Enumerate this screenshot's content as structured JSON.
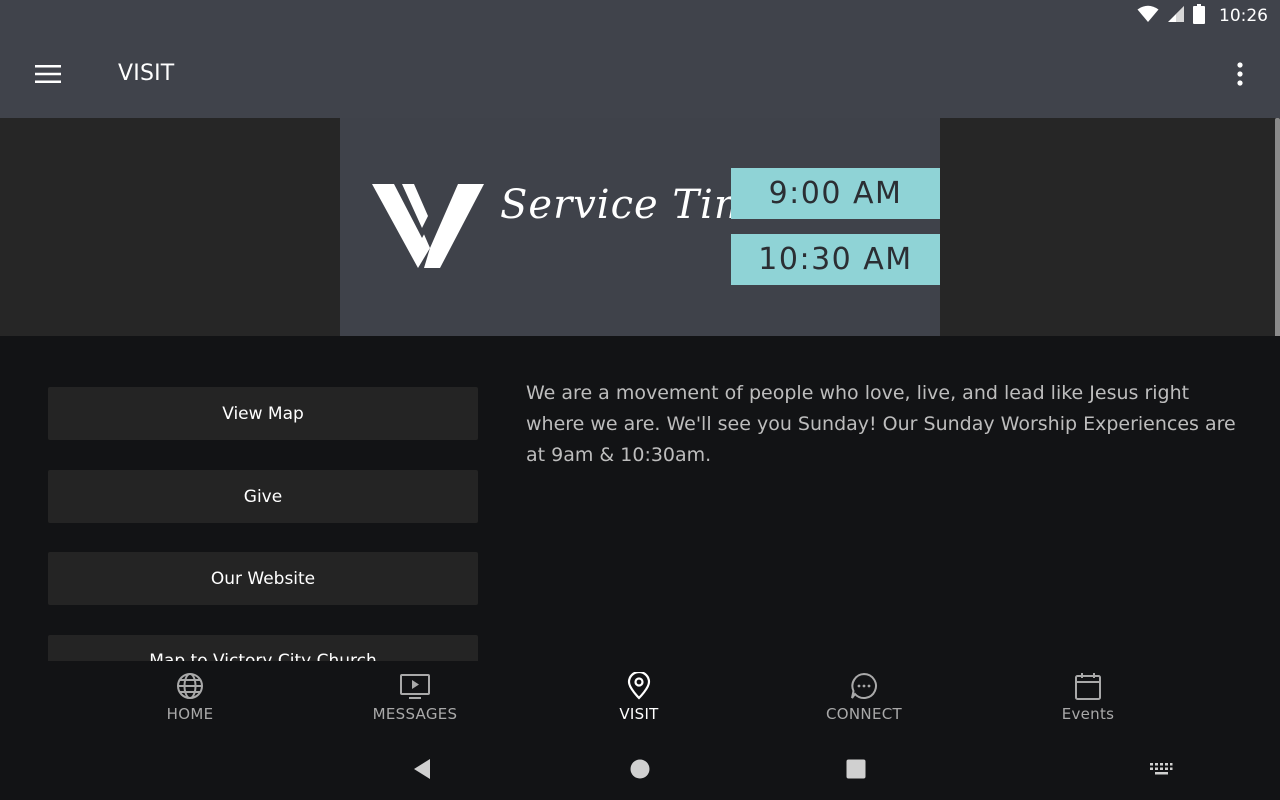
{
  "status": {
    "time": "10:26"
  },
  "appbar": {
    "title": "VISIT"
  },
  "hero": {
    "script_text": "Service Times",
    "times": [
      "9:00 AM",
      "10:30 AM"
    ],
    "accent_color": "#8fd3d6"
  },
  "actions": [
    {
      "label": "View Map"
    },
    {
      "label": "Give"
    },
    {
      "label": "Our Website"
    },
    {
      "label": "Map to Victory City Church"
    }
  ],
  "description": "We are a movement of people who love, live, and lead like Jesus right where we are. We'll see you Sunday! Our Sunday Worship Experiences are at 9am & 10:30am.",
  "bottom_nav": [
    {
      "label": "HOME",
      "icon": "globe-icon"
    },
    {
      "label": "MESSAGES",
      "icon": "tv-play-icon"
    },
    {
      "label": "VISIT",
      "icon": "location-pin-icon",
      "active": true
    },
    {
      "label": "CONNECT",
      "icon": "chat-bubble-icon"
    },
    {
      "label": "Events",
      "icon": "calendar-icon"
    }
  ]
}
